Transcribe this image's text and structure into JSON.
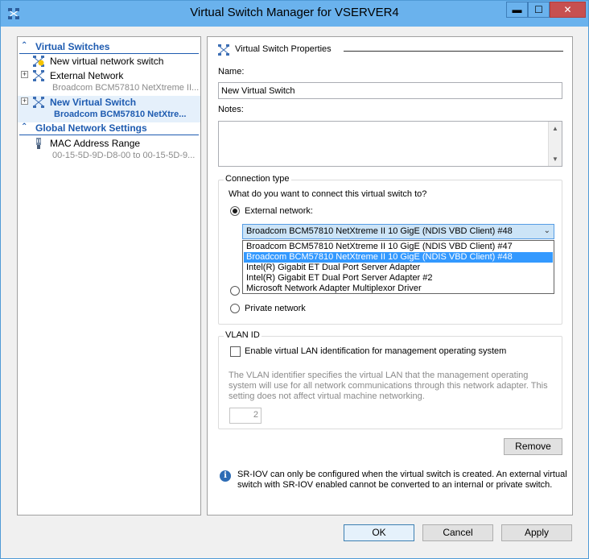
{
  "window": {
    "title": "Virtual Switch Manager for VSERVER4",
    "controls": {
      "minimize": "▬",
      "maximize": "☐",
      "close": "✕"
    }
  },
  "tree": {
    "virtual_switches_header": "Virtual Switches",
    "items": [
      {
        "label": "New virtual network switch",
        "sub": ""
      },
      {
        "label": "External Network",
        "sub": "Broadcom BCM57810 NetXtreme II..."
      },
      {
        "label": "New Virtual Switch",
        "sub": "Broadcom BCM57810 NetXtre...",
        "selected": true
      }
    ],
    "global_header": "Global Network Settings",
    "mac": {
      "label": "MAC Address Range",
      "sub": "00-15-5D-9D-D8-00 to 00-15-5D-9..."
    },
    "expander_collapsed": "+",
    "chevron": "⌃"
  },
  "props": {
    "header": "Virtual Switch Properties",
    "name_label": "Name:",
    "name_value": "New Virtual Switch",
    "notes_label": "Notes:",
    "notes_value": "",
    "scroll_up": "▲",
    "scroll_down": "▼",
    "connection": {
      "title": "Connection type",
      "question": "What do you want to connect this virtual switch to?",
      "external_label": "External network:",
      "selected_adapter": "Broadcom BCM57810 NetXtreme II 10 GigE (NDIS VBD Client) #48",
      "dropdown_arrow": "⌄",
      "options": [
        "Broadcom BCM57810 NetXtreme II 10 GigE (NDIS VBD Client) #47",
        "Broadcom BCM57810 NetXtreme II 10 GigE (NDIS VBD Client) #48",
        "Intel(R) Gigabit ET Dual Port Server Adapter",
        "Intel(R) Gigabit ET Dual Port Server Adapter #2",
        "Microsoft Network Adapter Multiplexor Driver"
      ],
      "selected_option_index": 1,
      "private_label": "Private network"
    },
    "vlan": {
      "title": "VLAN ID",
      "enable_label": "Enable virtual LAN identification for management operating system",
      "description": "The VLAN identifier specifies the virtual LAN that the management operating system will use for all network communications through this network adapter. This setting does not affect virtual machine networking.",
      "value": "2"
    },
    "remove_label": "Remove",
    "info_icon": "i",
    "info_text": "SR-IOV can only be configured when the virtual switch is created. An external virtual switch with SR-IOV enabled cannot be converted to an internal or private switch."
  },
  "footer": {
    "ok": "OK",
    "cancel": "Cancel",
    "apply": "Apply"
  }
}
